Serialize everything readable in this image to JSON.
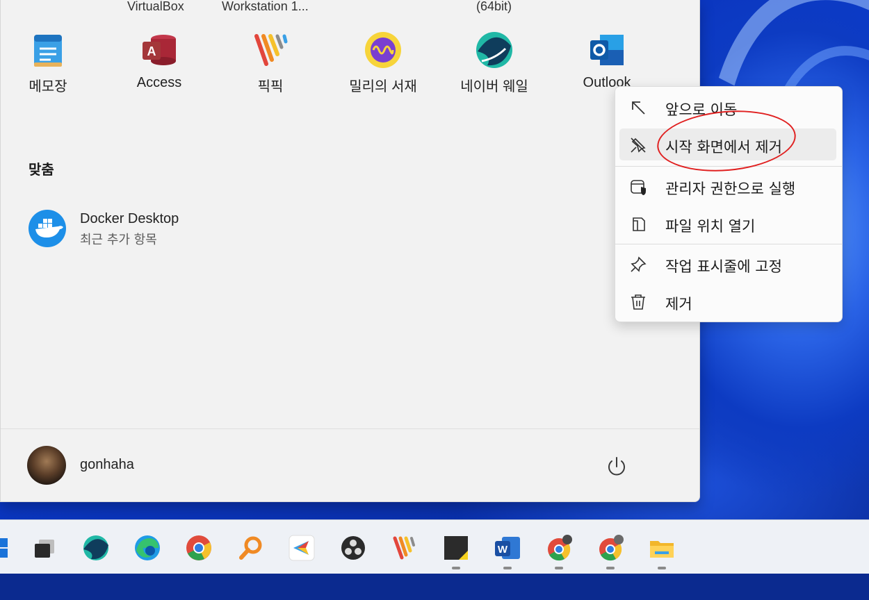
{
  "colors": {
    "accent": "#1d8fe8",
    "annotation": "#e02020",
    "menu_bg": "#f2f2f2"
  },
  "prev_row_labels": [
    "VirtualBox",
    "Workstation 1...",
    "(64bit)"
  ],
  "pinned_apps": [
    {
      "label": "메모장",
      "icon": "notepad-icon"
    },
    {
      "label": "Access",
      "icon": "access-icon"
    },
    {
      "label": "픽픽",
      "icon": "picpick-icon"
    },
    {
      "label": "밀리의 서재",
      "icon": "millie-icon"
    },
    {
      "label": "네이버 웨일",
      "icon": "naver-whale-icon"
    },
    {
      "label": "Outlook",
      "icon": "outlook-icon"
    }
  ],
  "recommended": {
    "title": "맞춤",
    "items": [
      {
        "name": "Docker Desktop",
        "subtitle": "최근 추가 항목",
        "icon": "docker-icon"
      }
    ]
  },
  "user": {
    "name": "gonhaha",
    "icon": "avatar"
  },
  "context_menu": {
    "items": [
      {
        "label": "앞으로 이동",
        "icon": "arrow-up-left-icon"
      },
      {
        "label": "시작 화면에서 제거",
        "icon": "unpin-icon"
      },
      {
        "label": "관리자 권한으로 실행",
        "icon": "admin-shield-icon"
      },
      {
        "label": "파일 위치 열기",
        "icon": "open-file-location-icon"
      },
      {
        "label": "작업 표시줄에 고정",
        "icon": "pin-icon"
      },
      {
        "label": "제거",
        "icon": "trash-icon"
      }
    ]
  },
  "taskbar": {
    "icons": [
      "start-icon",
      "task-view-icon",
      "naver-whale-icon",
      "edge-icon",
      "chrome-icon",
      "search-magnifier-icon",
      "app-arrow-icon",
      "obs-icon",
      "picpick-icon",
      "sticky-app-icon",
      "word-icon",
      "chrome-profile-icon",
      "chrome-profile-icon",
      "file-explorer-icon"
    ]
  }
}
